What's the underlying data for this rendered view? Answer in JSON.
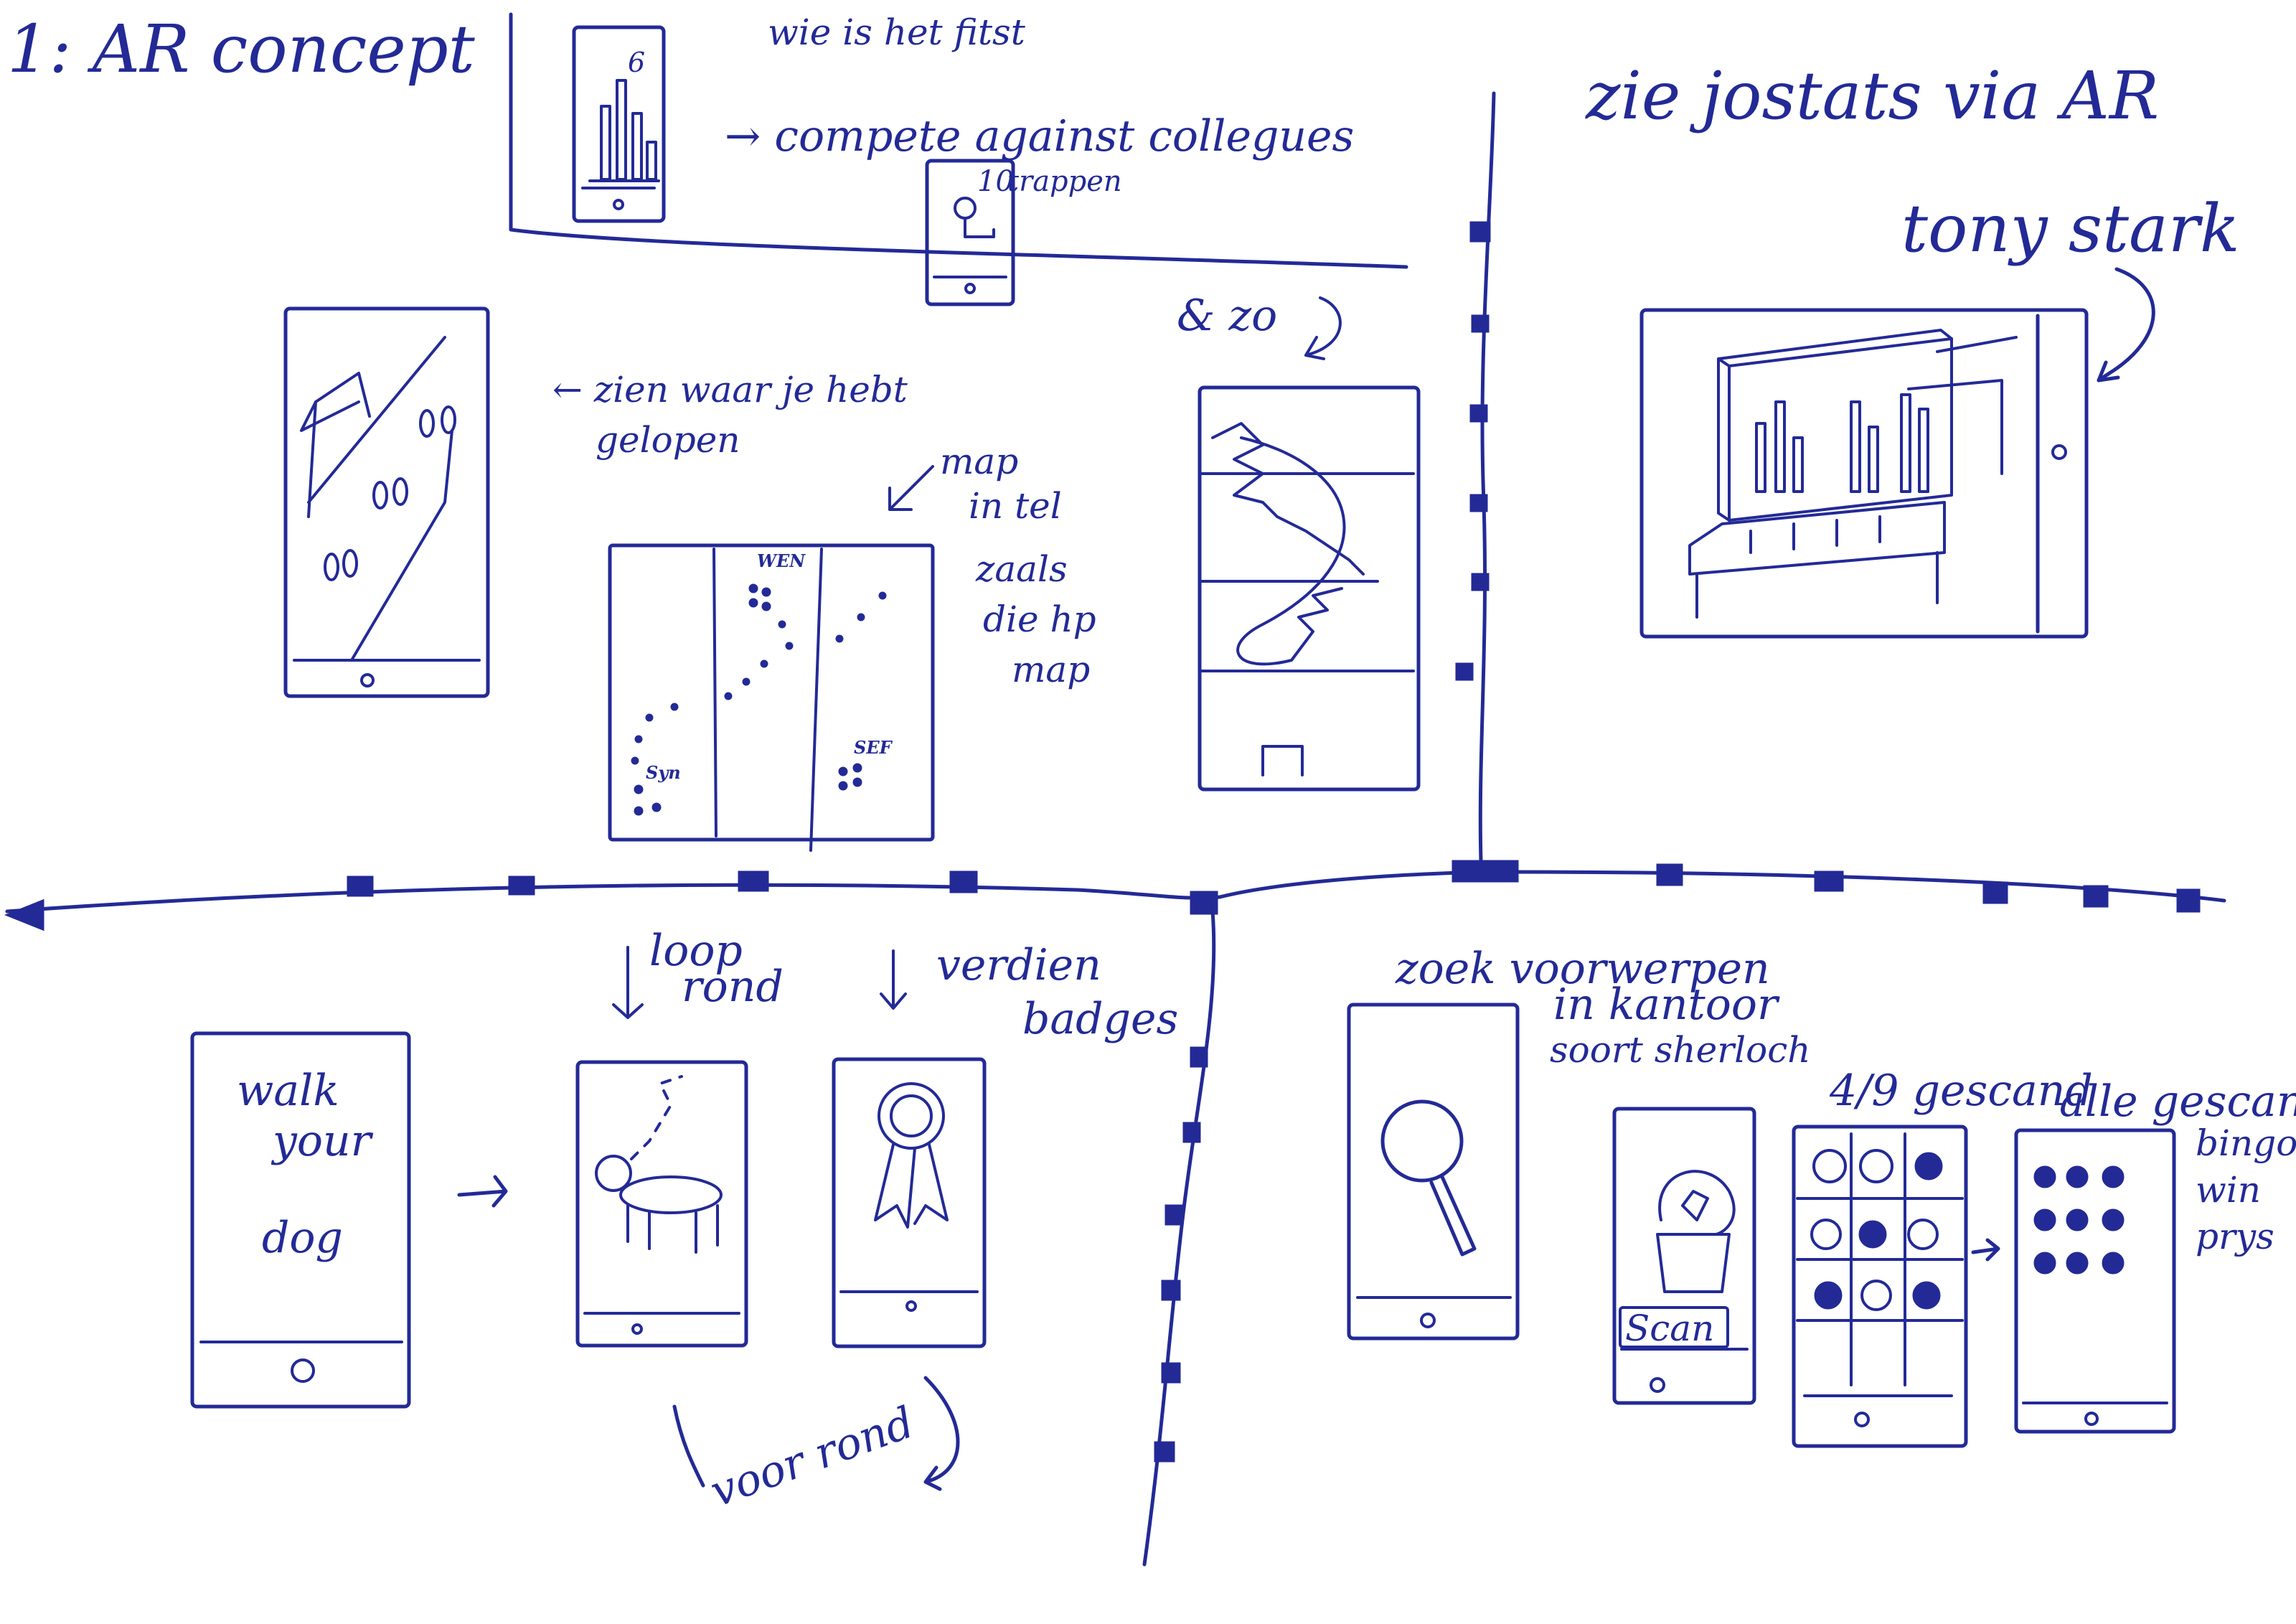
{
  "title": "1: AR concept",
  "top_center": {
    "heading": "wie is het fitst",
    "arrow_label": "→ compete against collegues",
    "phone_badge_number": "10",
    "phone_badge_label": "trappen"
  },
  "top_right": {
    "heading": "zie jostats via AR",
    "tony_label": "tony stark"
  },
  "left_panel": {
    "footprints_label_line1": "← zien waar je hebt",
    "footprints_label_line2": "gelopen",
    "map_label_line1": "map",
    "map_label_line2": "in tel",
    "rooms_label_line1": "zaals",
    "rooms_label_line2": "die hp",
    "rooms_label_line3": "map",
    "map_room_labels": [
      "WEN",
      "SEF",
      "Syn"
    ],
    "stairs_label": "& zo"
  },
  "bottom_left": {
    "phone_text_line1": "walk",
    "phone_text_line2": "your",
    "phone_text_line3": "dog",
    "loop_label_line1": "loop",
    "loop_label_line2": "rond",
    "badges_label_line1": "verdien",
    "badges_label_line2": "badges",
    "dog_label": "voor rond"
  },
  "bottom_right": {
    "search_label_line1": "zoek voorwerpen",
    "search_label_line2": "in kantoor",
    "search_label_line3": "soort sherloch",
    "scan_button": "Scan",
    "scanned_count": "4/9 gescand",
    "all_scanned": "alle gescand",
    "bingo_line1": "bingo",
    "bingo_line2": "win",
    "bingo_line3": "prys"
  }
}
